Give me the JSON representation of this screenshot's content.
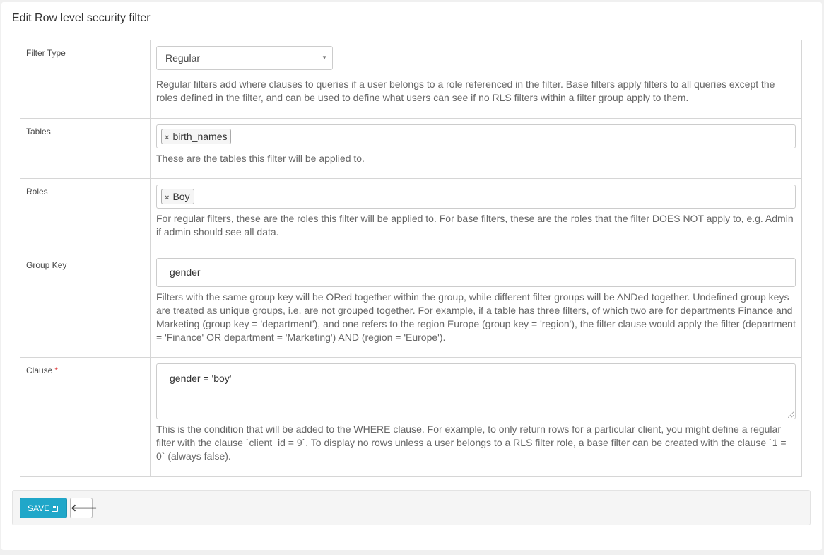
{
  "page": {
    "title": "Edit Row level security filter"
  },
  "form": {
    "filter_type": {
      "label": "Filter Type",
      "selected": "Regular",
      "help": "Regular filters add where clauses to queries if a user belongs to a role referenced in the filter. Base filters apply filters to all queries except the roles defined in the filter, and can be used to define what users can see if no RLS filters within a filter group apply to them."
    },
    "tables": {
      "label": "Tables",
      "tags": [
        "birth_names"
      ],
      "help": "These are the tables this filter will be applied to."
    },
    "roles": {
      "label": "Roles",
      "tags": [
        "Boy"
      ],
      "help": "For regular filters, these are the roles this filter will be applied to. For base filters, these are the roles that the filter DOES NOT apply to, e.g. Admin if admin should see all data."
    },
    "group_key": {
      "label": "Group Key",
      "value": "gender",
      "help": "Filters with the same group key will be ORed together within the group, while different filter groups will be ANDed together. Undefined group keys are treated as unique groups, i.e. are not grouped together. For example, if a table has three filters, of which two are for departments Finance and Marketing (group key = 'department'), and one refers to the region Europe (group key = 'region'), the filter clause would apply the filter (department = 'Finance' OR department = 'Marketing') AND (region = 'Europe')."
    },
    "clause": {
      "label": "Clause",
      "required_mark": "*",
      "value": "gender = 'boy'",
      "help": "This is the condition that will be added to the WHERE clause. For example, to only return rows for a particular client, you might define a regular filter with the clause `client_id = 9`. To display no rows unless a user belongs to a RLS filter role, a base filter can be created with the clause `1 = 0` (always false)."
    }
  },
  "actions": {
    "save_label": "SAVE",
    "save_icon": "floppy-disk-icon",
    "back_icon": "arrow-left-icon",
    "back_glyph": "🡐"
  },
  "colors": {
    "primary": "#20a7c9",
    "required": "#e04141"
  }
}
